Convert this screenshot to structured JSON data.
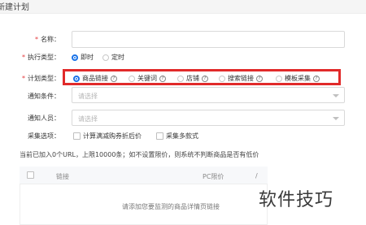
{
  "page": {
    "title": "新建计划"
  },
  "form": {
    "name": {
      "label": "名称：",
      "required": true,
      "value": ""
    },
    "exec_type": {
      "label": "执行类型：",
      "required": true,
      "options": [
        {
          "label": "即时",
          "selected": true
        },
        {
          "label": "定时",
          "selected": false
        }
      ]
    },
    "plan_type": {
      "label": "计划类型：",
      "required": true,
      "options": [
        {
          "label": "商品链接",
          "selected": true,
          "help": "?"
        },
        {
          "label": "关键词",
          "selected": false,
          "help": "?"
        },
        {
          "label": "店铺",
          "selected": false,
          "help": "?"
        },
        {
          "label": "搜索链接",
          "selected": false,
          "help": "?"
        },
        {
          "label": "模板采集",
          "selected": false,
          "help": "?"
        }
      ]
    },
    "notify_condition": {
      "label": "通知条件：",
      "placeholder": "请选择"
    },
    "notify_person": {
      "label": "通知人员：",
      "placeholder": "请选择"
    },
    "collect_options": {
      "label": "采集选项：",
      "options": [
        {
          "label": "计算满减购券折后价",
          "checked": false
        },
        {
          "label": "采集多款式",
          "checked": false
        }
      ]
    }
  },
  "info_text": "当前已加入0个URL，上限10000条；如不设置限价，则系统不判断商品是否有低价",
  "table": {
    "headers": [
      "链接",
      "PC限价",
      "/"
    ],
    "empty_text": "请添加您要监测的商品详情页链接"
  },
  "watermark": "软件技巧",
  "colors": {
    "accent": "#1a73e8",
    "highlight": "#e12a2a",
    "required": "#e4393c"
  }
}
